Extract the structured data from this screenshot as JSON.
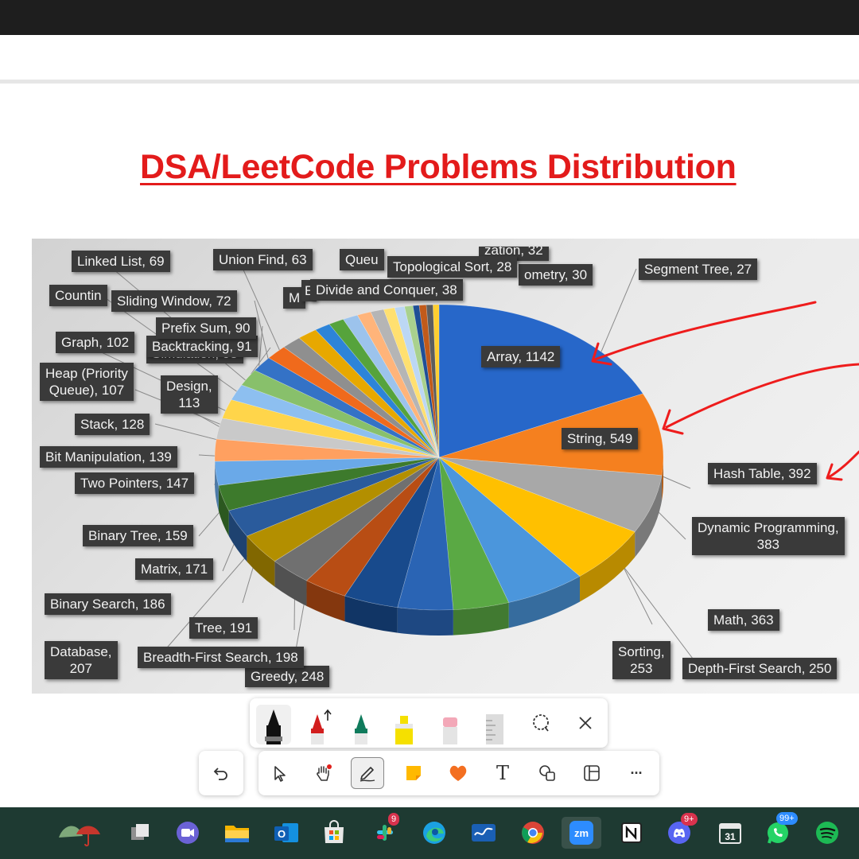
{
  "slide": {
    "title": "DSA/LeetCode Problems Distribution"
  },
  "chart_data": {
    "type": "pie",
    "title": "",
    "slices": [
      {
        "label": "Array",
        "value": 1142,
        "color": "#2767c9"
      },
      {
        "label": "String",
        "value": 549,
        "color": "#f5801f"
      },
      {
        "label": "Hash Table",
        "value": 392,
        "color": "#a8a8a8"
      },
      {
        "label": "Dynamic Programming",
        "value": 383,
        "color": "#ffc000"
      },
      {
        "label": "Math",
        "value": 363,
        "color": "#4b96dc"
      },
      {
        "label": "Sorting",
        "value": 253,
        "color": "#5aa944"
      },
      {
        "label": "Depth-First Search",
        "value": 250,
        "color": "#2a64b4"
      },
      {
        "label": "Greedy",
        "value": 248,
        "color": "#184a8c"
      },
      {
        "label": "Breadth-First Search",
        "value": 198,
        "color": "#b84d14"
      },
      {
        "label": "Tree",
        "value": 191,
        "color": "#707070"
      },
      {
        "label": "Database",
        "value": 207,
        "color": "#b38f00"
      },
      {
        "label": "Binary Search",
        "value": 186,
        "color": "#2a5b9c"
      },
      {
        "label": "Matrix",
        "value": 171,
        "color": "#3d7a2c"
      },
      {
        "label": "Binary Tree",
        "value": 159,
        "color": "#6aa9e8"
      },
      {
        "label": "Two Pointers",
        "value": 147,
        "color": "#ffa060"
      },
      {
        "label": "Bit Manipulation",
        "value": 139,
        "color": "#c9c9c9"
      },
      {
        "label": "Stack",
        "value": 128,
        "color": "#ffd54a"
      },
      {
        "label": "Heap (Priority Queue)",
        "value": 107,
        "color": "#8dbff0"
      },
      {
        "label": "Design",
        "value": 113,
        "color": "#88c06b"
      },
      {
        "label": "Graph",
        "value": 102,
        "color": "#3472c6"
      },
      {
        "label": "Simulation",
        "value": 98,
        "color": "#f06a1c"
      },
      {
        "label": "Backtracking",
        "value": 91,
        "color": "#8f8f8f"
      },
      {
        "label": "Prefix Sum",
        "value": 90,
        "color": "#e7a800"
      },
      {
        "label": "Sliding Window",
        "value": 72,
        "color": "#2d84d8"
      },
      {
        "label": "Counting",
        "value": 70,
        "color": "#56a33c"
      },
      {
        "label": "Linked List",
        "value": 69,
        "color": "#9cc3ec"
      },
      {
        "label": "Union Find",
        "value": 63,
        "color": "#ffb47a"
      },
      {
        "label": "M",
        "value": 60,
        "color": "#b5b5b5"
      },
      {
        "label": "E",
        "value": 50,
        "color": "#ffe070"
      },
      {
        "label": "Queu",
        "value": 45,
        "color": "#bcd7f4"
      },
      {
        "label": "Divide and Conquer",
        "value": 38,
        "color": "#a9d18e"
      },
      {
        "label": "Topological Sort",
        "value": 28,
        "color": "#1f4f96"
      },
      {
        "label": "zation, 32",
        "value": 32,
        "color": "#c15a1a"
      },
      {
        "label": "ometry, 30",
        "value": 30,
        "color": "#5d5d5d"
      },
      {
        "label": "Segment Tree",
        "value": 27,
        "color": "#ffcf30"
      }
    ]
  },
  "labels": {
    "array": "Array, 1142",
    "string": "String, 549",
    "hash_table": "Hash Table, 392",
    "dp_line1": "Dynamic Programming,",
    "dp_line2": "383",
    "math": "Math, 363",
    "sorting_line1": "Sorting,",
    "sorting_line2": "253",
    "dfs": "Depth-First Search, 250",
    "greedy": "Greedy, 248",
    "bfs": "Breadth-First Search, 198",
    "tree": "Tree, 191",
    "database_line1": "Database,",
    "database_line2": "207",
    "binary_search": "Binary Search, 186",
    "matrix": "Matrix, 171",
    "binary_tree": "Binary Tree, 159",
    "two_pointers": "Two Pointers, 147",
    "bit_manipulation": "Bit Manipulation, 139",
    "stack": "Stack, 128",
    "heap_line1": "Heap (Priority",
    "heap_line2": "Queue), 107",
    "design_line1": "Design,",
    "design_line2": "113",
    "graph": "Graph, 102",
    "simulation": "Simulation, 98",
    "backtracking": "Backtracking, 91",
    "prefix_sum": "Prefix Sum, 90",
    "sliding_window": "Sliding Window, 72",
    "counting": "Countin",
    "linked_list": "Linked List, 69",
    "union_find": "Union Find, 63",
    "m_label": "M",
    "e_label": "E",
    "queue": "Queu",
    "divide_conquer": "Divide and Conquer, 38",
    "topological": "Topological Sort, 28",
    "zation": "zation, 32",
    "geometry": "ometry, 30",
    "segment_tree": "Segment Tree, 27"
  },
  "annotation": {
    "ink_color": "#ee1c1c"
  },
  "pen_toolbar": {
    "tools": [
      "black-pen",
      "red-pen",
      "green-pen",
      "yellow-highlighter",
      "pink-eraser",
      "ruler",
      "lasso-select",
      "close"
    ]
  },
  "main_toolbar": {
    "tools": [
      "undo",
      "select",
      "pan-hand",
      "pen",
      "sticky-note",
      "reaction",
      "text",
      "shapes",
      "template",
      "more"
    ],
    "text_glyph": "T",
    "more_glyph": "···"
  },
  "taskbar": {
    "apps": [
      "weather",
      "task-view",
      "teams",
      "file-explorer",
      "outlook",
      "microsoft-store",
      "slack",
      "edge",
      "whiteboard",
      "chrome",
      "zoom",
      "notion",
      "discord",
      "calendar",
      "whatsapp",
      "spotify"
    ],
    "slack_badge": "9",
    "discord_badge": "9+",
    "whatsapp_badge": "99+",
    "zoom_text": "zm",
    "calendar_text": "31"
  }
}
